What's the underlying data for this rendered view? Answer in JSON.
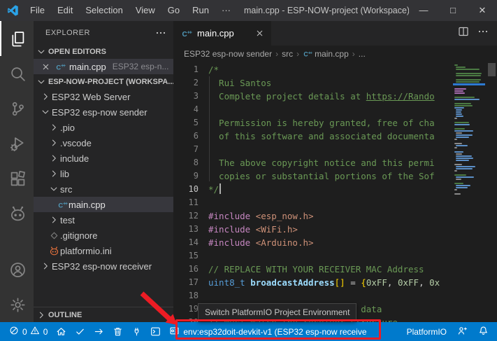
{
  "window": {
    "title": "main.cpp - ESP-NOW-project (Workspace) - ...",
    "menus": [
      "File",
      "Edit",
      "Selection",
      "View",
      "Go",
      "Run",
      "···"
    ],
    "controls": {
      "minimize": "—",
      "maximize": "□",
      "close": "✕"
    }
  },
  "activity_bar": {
    "top": [
      {
        "id": "explorer",
        "icon": "files",
        "active": true
      },
      {
        "id": "search",
        "icon": "search",
        "active": false
      },
      {
        "id": "source-control",
        "icon": "source-control",
        "active": false
      },
      {
        "id": "run-and-debug",
        "icon": "run-debug",
        "active": false
      },
      {
        "id": "extensions",
        "icon": "extensions",
        "active": false
      },
      {
        "id": "platformio",
        "icon": "platformio-alien",
        "active": false
      }
    ],
    "bottom": [
      {
        "id": "accounts",
        "icon": "account",
        "active": false
      },
      {
        "id": "manage",
        "icon": "settings-gear",
        "active": false
      }
    ]
  },
  "sidebar": {
    "title": "EXPLORER",
    "open_editors": {
      "label": "OPEN EDITORS",
      "items": [
        {
          "name": "main.cpp",
          "desc": "ESP32 esp-n...",
          "icon": "cpp-file"
        }
      ]
    },
    "workspace": {
      "label": "ESP-NOW-PROJECT (WORKSPA..."
    },
    "tree": [
      {
        "label": "ESP32 Web Server",
        "chevron": "right",
        "level": 0
      },
      {
        "label": "ESP32 esp-now sender",
        "chevron": "down",
        "level": 0
      },
      {
        "label": ".pio",
        "chevron": "right",
        "level": 1
      },
      {
        "label": ".vscode",
        "chevron": "right",
        "level": 1
      },
      {
        "label": "include",
        "chevron": "right",
        "level": 1
      },
      {
        "label": "lib",
        "chevron": "right",
        "level": 1
      },
      {
        "label": "src",
        "chevron": "down",
        "level": 1
      },
      {
        "label": "main.cpp",
        "icon": "cpp-file",
        "level": 2,
        "selected": true
      },
      {
        "label": "test",
        "chevron": "right",
        "level": 1
      },
      {
        "label": ".gitignore",
        "icon": "git-diamond",
        "level": 1
      },
      {
        "label": "platformio.ini",
        "icon": "platformio-file",
        "level": 1
      },
      {
        "label": "ESP32 esp-now receiver",
        "chevron": "right",
        "level": 0
      }
    ],
    "outline": {
      "label": "OUTLINE"
    }
  },
  "editor": {
    "tab": {
      "name": "main.cpp",
      "close": "✕"
    },
    "breadcrumb": {
      "separator": "›",
      "items": [
        {
          "label": "ESP32 esp-now sender"
        },
        {
          "label": "src"
        },
        {
          "label": "main.cpp",
          "icon": "cpp-file"
        },
        {
          "label": "..."
        }
      ]
    },
    "active_line": 10,
    "token_colors": {
      "c": "#6A9955",
      "l": "#6A9955",
      "p": "#C586C0",
      "s": "#CE9178",
      "t": "#569CD6",
      "v": "#9CDCFE",
      "n": "#B5CEA8",
      "d": "#D4D4D4",
      "br": "#FFD700"
    },
    "code": [
      {
        "n": 1,
        "segs": [
          [
            "/*",
            "c"
          ]
        ]
      },
      {
        "n": 2,
        "segs": [
          [
            "  Rui Santos",
            "c"
          ]
        ]
      },
      {
        "n": 3,
        "segs": [
          [
            "  Complete project details at ",
            "c"
          ],
          [
            "https://Rando",
            "l"
          ]
        ]
      },
      {
        "n": 4,
        "segs": []
      },
      {
        "n": 5,
        "segs": [
          [
            "  Permission is hereby granted, free of cha",
            "c"
          ]
        ]
      },
      {
        "n": 6,
        "segs": [
          [
            "  of this software and associated documenta",
            "c"
          ]
        ]
      },
      {
        "n": 7,
        "segs": []
      },
      {
        "n": 8,
        "segs": [
          [
            "  The above copyright notice and this permi",
            "c"
          ]
        ]
      },
      {
        "n": 9,
        "segs": [
          [
            "  copies or substantial portions of the Sof",
            "c"
          ]
        ]
      },
      {
        "n": 10,
        "segs": [
          [
            "*/",
            "c"
          ]
        ],
        "cursor": true
      },
      {
        "n": 11,
        "segs": []
      },
      {
        "n": 12,
        "segs": [
          [
            "#include ",
            "p"
          ],
          [
            "<esp_now.h>",
            "s"
          ]
        ]
      },
      {
        "n": 13,
        "segs": [
          [
            "#include ",
            "p"
          ],
          [
            "<WiFi.h>",
            "s"
          ]
        ]
      },
      {
        "n": 14,
        "segs": [
          [
            "#include ",
            "p"
          ],
          [
            "<Arduino.h>",
            "s"
          ]
        ]
      },
      {
        "n": 15,
        "segs": []
      },
      {
        "n": 16,
        "segs": [
          [
            "// REPLACE WITH YOUR RECEIVER MAC Address",
            "c"
          ]
        ]
      },
      {
        "n": 17,
        "segs": [
          [
            "uint8_t",
            "t"
          ],
          [
            " ",
            "d"
          ],
          [
            "broadcastAddress",
            "v"
          ],
          [
            "[]",
            "br"
          ],
          [
            " = ",
            "d"
          ],
          [
            "{",
            "br"
          ],
          [
            "0xFF",
            "n"
          ],
          [
            ", ",
            "d"
          ],
          [
            "0xFF",
            "n"
          ],
          [
            ", ",
            "d"
          ],
          [
            "0x",
            "n"
          ]
        ]
      },
      {
        "n": 18,
        "segs": []
      },
      {
        "n": 19,
        "segs": [
          [
            "// Structure example to send data",
            "c"
          ]
        ]
      },
      {
        "n": 20,
        "segs": [
          [
            "// Must match the receiver structure",
            "c"
          ]
        ]
      }
    ],
    "minimap": {
      "colors": {
        "g": "#4b7a43",
        "b": "#5b8fc7",
        "p": "#a66bae",
        "w": "#8a8a8a",
        "o": "#c08a5a",
        "hl": "#2d7ad1"
      },
      "rows": [
        [
          "g",
          5,
          2
        ],
        [
          "g",
          14,
          4
        ],
        [
          "g",
          34,
          4
        ],
        [
          "x",
          0,
          0
        ],
        [
          "g",
          37,
          4
        ],
        [
          "g",
          36,
          4
        ],
        [
          "x",
          0,
          0
        ],
        [
          "g",
          36,
          4
        ],
        [
          "g",
          34,
          4
        ],
        [
          "hl",
          46,
          0
        ],
        [
          "x",
          0,
          0
        ],
        [
          "p",
          17,
          2
        ],
        [
          "p",
          13,
          2
        ],
        [
          "p",
          15,
          2
        ],
        [
          "x",
          0,
          0
        ],
        [
          "g",
          29,
          2
        ],
        [
          "b",
          36,
          2
        ],
        [
          "x",
          0,
          0
        ],
        [
          "g",
          24,
          2
        ],
        [
          "g",
          26,
          2
        ],
        [
          "b",
          14,
          2
        ],
        [
          "b",
          9,
          4
        ],
        [
          "b",
          8,
          4
        ],
        [
          "b",
          9,
          4
        ],
        [
          "b",
          11,
          4
        ],
        [
          "w",
          4,
          2
        ],
        [
          "x",
          0,
          0
        ],
        [
          "g",
          21,
          2
        ],
        [
          "b",
          22,
          2
        ],
        [
          "x",
          0,
          0
        ],
        [
          "g",
          15,
          2
        ],
        [
          "b",
          27,
          2
        ],
        [
          "w",
          9,
          4
        ],
        [
          "b",
          24,
          4
        ],
        [
          "b",
          19,
          4
        ],
        [
          "w",
          4,
          2
        ],
        [
          "x",
          0,
          0
        ],
        [
          "w",
          11,
          2
        ],
        [
          "b",
          17,
          4
        ],
        [
          "w",
          4,
          2
        ],
        [
          "x",
          0,
          0
        ],
        [
          "b",
          13,
          2
        ],
        [
          "w",
          9,
          4
        ],
        [
          "b",
          23,
          4
        ],
        [
          "b",
          25,
          4
        ],
        [
          "b",
          19,
          4
        ],
        [
          "x",
          0,
          0
        ],
        [
          "w",
          11,
          2
        ],
        [
          "b",
          28,
          4
        ],
        [
          "b",
          24,
          4
        ],
        [
          "w",
          4,
          2
        ],
        [
          "x",
          0,
          0
        ],
        [
          "g",
          17,
          2
        ],
        [
          "b",
          26,
          4
        ],
        [
          "w",
          8,
          4
        ],
        [
          "x",
          0,
          0
        ],
        [
          "g",
          13,
          2
        ],
        [
          "b",
          21,
          4
        ],
        [
          "b",
          17,
          4
        ],
        [
          "w",
          4,
          2
        ],
        [
          "x",
          0,
          0
        ],
        [
          "w",
          9,
          2
        ]
      ]
    }
  },
  "tooltip": {
    "text": "Switch PlatformIO Project Environment"
  },
  "status_bar": {
    "bg": "#007acc",
    "problems": {
      "errors": "0",
      "warnings": "0"
    },
    "pio_buttons": [
      {
        "id": "pio-home",
        "icon": "home"
      },
      {
        "id": "pio-build",
        "icon": "check"
      },
      {
        "id": "pio-upload",
        "icon": "arrow-right"
      },
      {
        "id": "pio-clean",
        "icon": "trash"
      },
      {
        "id": "pio-serial-monitor",
        "icon": "plug"
      },
      {
        "id": "pio-new-terminal",
        "icon": "terminal"
      }
    ],
    "env_label": "env:esp32doit-devkit-v1 (ESP32 esp-now receive",
    "right_label": "PlatformIO"
  },
  "annotations": {
    "color": "#ec1c24"
  }
}
